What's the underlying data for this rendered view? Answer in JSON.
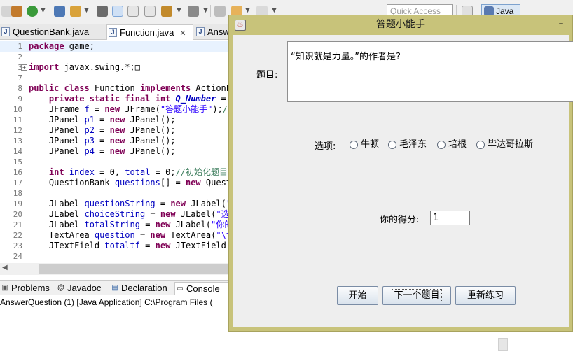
{
  "ide": {
    "quick_access_placeholder": "Quick Access",
    "perspective_label": "Java",
    "editor_tabs": [
      {
        "label": "QuestionBank.java"
      },
      {
        "label": "Function.java",
        "close": "✕"
      },
      {
        "label": "Answ"
      }
    ],
    "code_lines": [
      {
        "num": "1",
        "html": "<span class=\"kw\">package</span> game;"
      },
      {
        "num": "2",
        "html": ""
      },
      {
        "num": "3",
        "html": "<span class=\"kw\">import</span> javax.swing.*;□"
      },
      {
        "num": "7",
        "html": ""
      },
      {
        "num": "8",
        "html": "<span class=\"kw\">public class</span> Function <span class=\"kw\">implements</span> ActionLi"
      },
      {
        "num": "9",
        "html": "    <span class=\"kw\">private static final int</span> <span class=\"sfld\">Q_Number</span> = 1"
      },
      {
        "num": "10",
        "html": "    JFrame <span class=\"fld\">f</span> = <span class=\"kw\">new</span> JFrame(<span class=\"str\">\"答题小能手\"</span>);<span class=\"cmt\">//JF</span>"
      },
      {
        "num": "11",
        "html": "    JPanel <span class=\"fld\">p1</span> = <span class=\"kw\">new</span> JPanel();"
      },
      {
        "num": "12",
        "html": "    JPanel <span class=\"fld\">p2</span> = <span class=\"kw\">new</span> JPanel();"
      },
      {
        "num": "13",
        "html": "    JPanel <span class=\"fld\">p3</span> = <span class=\"kw\">new</span> JPanel();"
      },
      {
        "num": "14",
        "html": "    JPanel <span class=\"fld\">p4</span> = <span class=\"kw\">new</span> JPanel();"
      },
      {
        "num": "15",
        "html": ""
      },
      {
        "num": "16",
        "html": "    <span class=\"kw\">int</span> <span class=\"fld\">index</span> = 0, <span class=\"fld\">total</span> = 0;<span class=\"cmt\">//初始化题目下标和</span>"
      },
      {
        "num": "17",
        "html": "    QuestionBank <span class=\"fld\">questions</span>[] = <span class=\"kw\">new</span> Questi"
      },
      {
        "num": "18",
        "html": ""
      },
      {
        "num": "19",
        "html": "    JLabel <span class=\"fld\">questionString</span> = <span class=\"kw\">new</span> JLabel(<span class=\"str\">\"题</span>"
      },
      {
        "num": "20",
        "html": "    JLabel <span class=\"fld\">choiceString</span> = <span class=\"kw\">new</span> JLabel(<span class=\"str\">\"选项</span>"
      },
      {
        "num": "21",
        "html": "    JLabel <span class=\"fld\">totalString</span> = <span class=\"kw\">new</span> JLabel(<span class=\"str\">\"你的得</span>"
      },
      {
        "num": "22",
        "html": "    TextArea <span class=\"fld\">question</span> = <span class=\"kw\">new</span> TextArea(<span class=\"str\">\"\\t</span>"
      },
      {
        "num": "23",
        "html": "    JTextField <span class=\"fld\">totaltf</span> = <span class=\"kw\">new</span> JTextField(<span class=\"str\">\"</span>"
      },
      {
        "num": "24",
        "html": ""
      }
    ],
    "bottom_tabs": [
      {
        "label": "Problems",
        "icon": "problems-icon"
      },
      {
        "label": "Javadoc",
        "icon": "at-icon"
      },
      {
        "label": "Declaration",
        "icon": "declaration-icon"
      },
      {
        "label": "Console",
        "icon": "console-icon"
      }
    ],
    "console_text": "AnswerQuestion (1) [Java Application] C:\\Program Files ("
  },
  "dialog": {
    "title": "答题小能手",
    "minimize": "–",
    "question_label": "题目:",
    "question_text": "“知识就是力量。”的作者是?",
    "options_label": "选项:",
    "options": [
      "牛顿",
      "毛泽东",
      "培根",
      "毕达哥拉斯"
    ],
    "score_label": "你的得分:",
    "score_value": "1",
    "buttons": {
      "start": "开始",
      "next": "下一个题目",
      "retry": "重新练习"
    }
  }
}
